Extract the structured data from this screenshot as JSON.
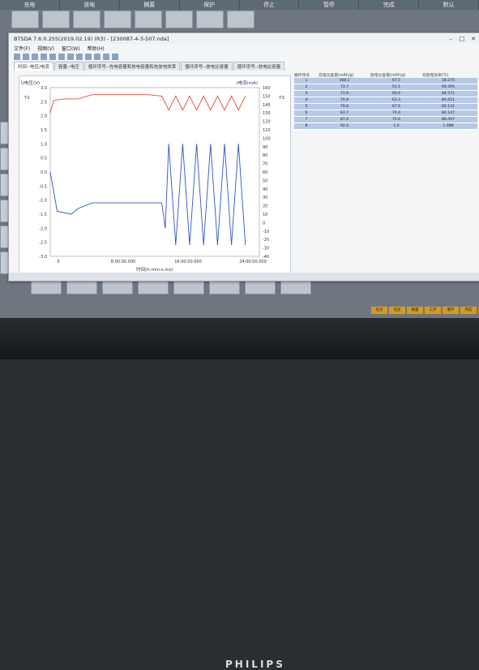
{
  "top_buttons": [
    "充电",
    "放电",
    "搁置",
    "保护",
    "停止",
    "暂停",
    "完成",
    "默认"
  ],
  "window": {
    "title": "BTSDA 7.6.0.255(2019.02.19) (R3) - [230087-4-3-507.nda]",
    "menu": [
      "文件(F)",
      "视图(V)",
      "窗口(W)",
      "帮助(H)"
    ],
    "tabs": [
      "时间--电压/电流",
      "容量--电压",
      "循环序号--充电容量和放电容量和充放电效率",
      "循环序号--放电比容量",
      "循环序号--放电比容量"
    ]
  },
  "plot": {
    "left_axis_label": "U电压(V)",
    "right_axis_label": "I电流(mA)",
    "x_axis_label": "时间(h:min:s.ms)",
    "y2_label": "Y2",
    "y3_label": "Y3",
    "x_ticks": [
      "0",
      "8:00:00.000",
      "16:00:00.000",
      "24:00:00.000"
    ],
    "left_ticks": [
      "3.0",
      "2.5",
      "2.0",
      "1.5",
      "1.0",
      "0.5",
      "0.0",
      "-0.5",
      "-1.0",
      "-1.5",
      "-2.0",
      "-2.5",
      "-3.0"
    ],
    "right_ticks": [
      "160",
      "150",
      "140",
      "130",
      "120",
      "110",
      "100",
      "90",
      "80",
      "70",
      "60",
      "50",
      "40",
      "30",
      "20",
      "10",
      "0",
      "-10",
      "-20",
      "-30",
      "-40"
    ]
  },
  "chart_data": {
    "type": "line",
    "xlabel": "时间(h:min:s.ms)",
    "ylabel": "U电压(V)",
    "y2label": "I电流(mA)",
    "series": [
      {
        "name": "U电压(V)",
        "color": "#e24b3b",
        "points": [
          [
            0,
            2.1
          ],
          [
            0.5,
            2.55
          ],
          [
            2,
            2.6
          ],
          [
            4,
            2.6
          ],
          [
            6,
            2.75
          ],
          [
            8,
            2.75
          ],
          [
            10,
            2.75
          ],
          [
            12,
            2.75
          ],
          [
            14,
            2.75
          ],
          [
            16,
            2.7
          ],
          [
            17,
            2.2
          ],
          [
            18,
            2.7
          ],
          [
            19,
            2.2
          ],
          [
            20,
            2.7
          ],
          [
            21,
            2.2
          ],
          [
            22,
            2.7
          ],
          [
            23,
            2.2
          ],
          [
            24,
            2.7
          ],
          [
            25,
            2.2
          ],
          [
            26,
            2.7
          ],
          [
            27,
            2.2
          ],
          [
            28,
            2.7
          ]
        ]
      },
      {
        "name": "I电流(mA)",
        "color": "#2f56c4",
        "points": [
          [
            0,
            0
          ],
          [
            1,
            -1.4
          ],
          [
            3,
            -1.5
          ],
          [
            4,
            -1.3
          ],
          [
            6,
            -1.1
          ],
          [
            8,
            -1.1
          ],
          [
            10,
            -1.1
          ],
          [
            12,
            -1.1
          ],
          [
            14,
            -1.1
          ],
          [
            16,
            -1.1
          ],
          [
            16.5,
            -2
          ],
          [
            17,
            1.0
          ],
          [
            18,
            -2.6
          ],
          [
            19,
            1.0
          ],
          [
            20,
            -2.6
          ],
          [
            21,
            1.0
          ],
          [
            22,
            -2.6
          ],
          [
            23,
            1.0
          ],
          [
            24,
            -2.6
          ],
          [
            25,
            1.0
          ],
          [
            26,
            -2.6
          ],
          [
            27,
            1.0
          ],
          [
            28,
            -2.6
          ]
        ]
      }
    ],
    "xlim": [
      0,
      30
    ],
    "ylim": [
      -3.0,
      3.0
    ]
  },
  "table": {
    "headers": [
      "循环序号",
      "充电比容量(mAh/g)",
      "放电比容量(mAh/g)",
      "充放电效率(%)"
    ],
    "rows": [
      [
        "1",
        "368.1",
        "67.5",
        "18.275"
      ],
      [
        "2",
        "73.7",
        "51.1",
        "69.395"
      ],
      [
        "3",
        "71.9",
        "60.6",
        "84.571"
      ],
      [
        "4",
        "74.8",
        "63.3",
        "84.651"
      ],
      [
        "5",
        "79.6",
        "67.6",
        "85.131"
      ],
      [
        "6",
        "83.7",
        "70.4",
        "84.147"
      ],
      [
        "7",
        "87.4",
        "75.6",
        "86.497"
      ],
      [
        "8",
        "92.4",
        "1.0",
        "1.088"
      ]
    ]
  },
  "tray_buttons": [
    "恒流",
    "恒压",
    "静置",
    "工步",
    "循环",
    "完成",
    "暂停"
  ],
  "brand": "PHILIPS"
}
